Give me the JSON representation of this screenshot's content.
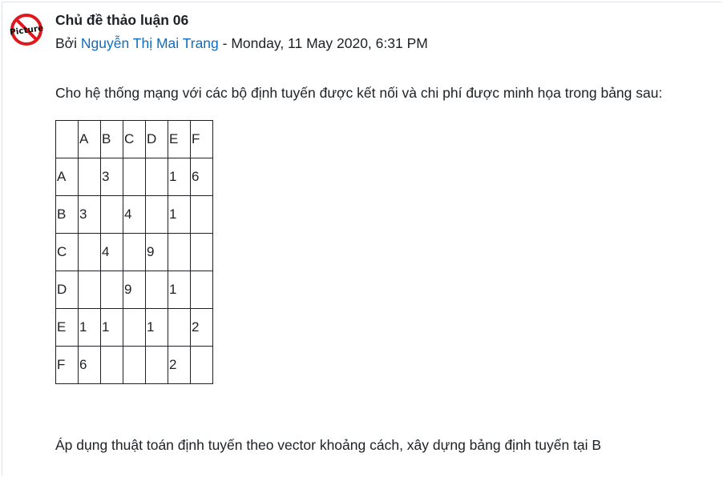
{
  "post": {
    "avatar_text": "Picture",
    "subject": "Chủ đề thảo luận 06",
    "by_prefix": "Bởi",
    "author": "Nguyễn Thị Mai Trang",
    "separator": "-",
    "datetime": "Monday, 11 May 2020, 6:31 PM",
    "intro": "Cho hệ thống mạng với các bộ định tuyến được kết nối và chi phí được minh họa trong bảng sau:",
    "table": {
      "header": [
        "",
        "A",
        "B",
        "C",
        "D",
        "E",
        "F"
      ],
      "rows": [
        [
          "A",
          "",
          "3",
          "",
          "",
          "1",
          "6"
        ],
        [
          "B",
          "3",
          "",
          "4",
          "",
          "1",
          ""
        ],
        [
          "C",
          "",
          "4",
          "",
          "9",
          "",
          ""
        ],
        [
          "D",
          "",
          "",
          "9",
          "",
          "1",
          ""
        ],
        [
          "E",
          "1",
          "1",
          "",
          "1",
          "",
          "2"
        ],
        [
          "F",
          "6",
          "",
          "",
          "",
          "2",
          ""
        ]
      ]
    },
    "outro": "Áp dụng thuật toán định tuyến theo vector khoảng cách, xây dựng bảng định tuyến tại B"
  },
  "colors": {
    "link": "#0f6cbf",
    "text": "#1d2125",
    "avatar_red": "#e0181e"
  }
}
